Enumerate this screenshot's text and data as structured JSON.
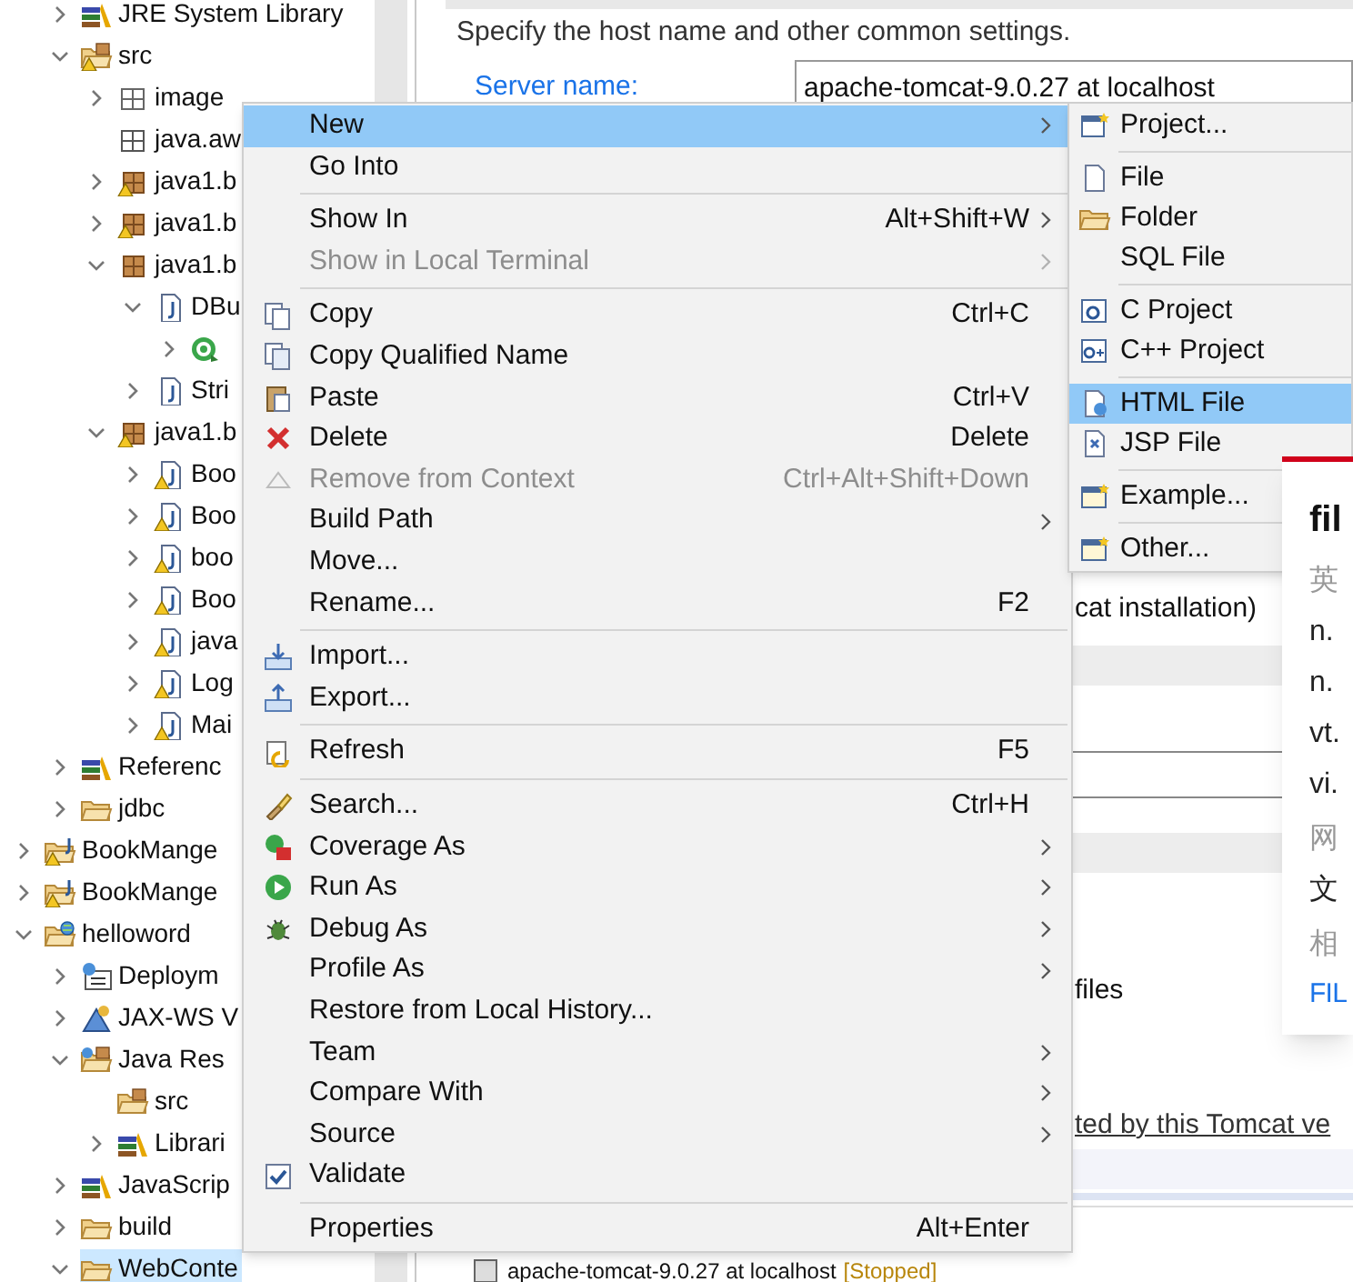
{
  "editor": {
    "description": "Specify the host name and other common settings.",
    "server_name_label": "Server name:",
    "server_name_value": "apache-tomcat-9.0.27 at localhost",
    "fragments": [
      {
        "kind": "runtime",
        "text": "cat installation)"
      },
      {
        "kind": "files",
        "text": "files"
      },
      {
        "kind": "link",
        "text": "ted by this Tomcat ve"
      }
    ]
  },
  "tree": {
    "continued_items": [
      {
        "label": "JRE System Library",
        "kind": "library",
        "expanded": false,
        "selected": false
      },
      {
        "label": "src",
        "kind": "source-folder-warning",
        "expanded": true,
        "selected": false,
        "children": [
          {
            "label": "image",
            "kind": "package-outline",
            "expanded": false,
            "selected": false
          },
          {
            "label": "java.aw",
            "kind": "package-empty",
            "selected": false
          },
          {
            "label": "java1.b",
            "kind": "package-warning",
            "expanded": false,
            "selected": false
          },
          {
            "label": "java1.b",
            "kind": "package-warning",
            "expanded": false,
            "selected": false
          },
          {
            "label": "java1.b",
            "kind": "package",
            "expanded": true,
            "selected": false,
            "children": [
              {
                "label": "DBu",
                "kind": "java-file",
                "expanded": true,
                "selected": false,
                "children": [
                  {
                    "kind": "class",
                    "expanded": false,
                    "selected": false
                  }
                ]
              },
              {
                "label": "Stri",
                "kind": "java-file",
                "expanded": false,
                "selected": false
              }
            ]
          },
          {
            "label": "java1.b",
            "kind": "package-warning",
            "expanded": true,
            "selected": false,
            "children": [
              {
                "label": "Boo",
                "kind": "java-file-warning",
                "expanded": false,
                "selected": false
              },
              {
                "label": "Boo",
                "kind": "java-file-warning",
                "expanded": false,
                "selected": false
              },
              {
                "label": "boo",
                "kind": "java-file-warning",
                "expanded": false,
                "selected": false
              },
              {
                "label": "Boo",
                "kind": "java-file-warning",
                "expanded": false,
                "selected": false
              },
              {
                "label": "java",
                "kind": "java-file-warning",
                "expanded": false,
                "selected": false
              },
              {
                "label": "Log",
                "kind": "java-file-warning",
                "expanded": false,
                "selected": false
              },
              {
                "label": "Mai",
                "kind": "java-file-warning",
                "expanded": false,
                "selected": false
              }
            ]
          }
        ]
      },
      {
        "label": "Referenc",
        "kind": "library",
        "expanded": false,
        "selected": false
      },
      {
        "label": "jdbc",
        "kind": "folder",
        "expanded": false,
        "selected": false
      }
    ],
    "items": [
      {
        "label": "BookMange",
        "kind": "project-warning",
        "expanded": false,
        "selected": false
      },
      {
        "label": "BookMange",
        "kind": "project-warning",
        "expanded": false,
        "selected": false
      },
      {
        "label": "helloword",
        "kind": "web-project",
        "expanded": true,
        "selected": false,
        "children": [
          {
            "label": "Deploym",
            "kind": "deployment",
            "expanded": false,
            "selected": false
          },
          {
            "label": "JAX-WS V",
            "kind": "webservices",
            "expanded": false,
            "selected": false
          },
          {
            "label": "Java Res",
            "kind": "java-resources",
            "expanded": true,
            "selected": false,
            "children": [
              {
                "label": "src",
                "kind": "source-folder",
                "selected": false
              },
              {
                "label": "Librari",
                "kind": "library",
                "expanded": false,
                "selected": false
              }
            ]
          },
          {
            "label": "JavaScrip",
            "kind": "library",
            "expanded": false,
            "selected": false
          },
          {
            "label": "build",
            "kind": "folder",
            "expanded": false,
            "selected": false
          },
          {
            "label": "WebConte",
            "kind": "folder",
            "expanded": true,
            "selected": true
          }
        ]
      }
    ]
  },
  "context_menu": {
    "items": [
      {
        "kind": "item",
        "label": "New",
        "submenu": true,
        "disabled": false,
        "selected": true
      },
      {
        "kind": "item",
        "label": "Go Into",
        "submenu": false,
        "disabled": false,
        "selected": false
      },
      {
        "kind": "separator"
      },
      {
        "kind": "item",
        "label": "Show In",
        "shortcut": "Alt+Shift+W",
        "submenu": true,
        "disabled": false,
        "selected": false
      },
      {
        "kind": "item",
        "label": "Show in Local Terminal",
        "submenu": true,
        "disabled": true,
        "selected": false
      },
      {
        "kind": "separator"
      },
      {
        "kind": "item",
        "label": "Copy",
        "shortcut": "Ctrl+C",
        "submenu": false,
        "disabled": false,
        "selected": false
      },
      {
        "kind": "item",
        "label": "Copy Qualified Name",
        "submenu": false,
        "disabled": false,
        "selected": false
      },
      {
        "kind": "item",
        "label": "Paste",
        "shortcut": "Ctrl+V",
        "submenu": false,
        "disabled": false,
        "selected": false
      },
      {
        "kind": "item",
        "label": "Delete",
        "shortcut": "Delete",
        "submenu": false,
        "disabled": false,
        "selected": false
      },
      {
        "kind": "item",
        "label": "Remove from Context",
        "shortcut": "Ctrl+Alt+Shift+Down",
        "submenu": false,
        "disabled": true,
        "selected": false
      },
      {
        "kind": "item",
        "label": "Build Path",
        "submenu": true,
        "disabled": false,
        "selected": false
      },
      {
        "kind": "item",
        "label": "Move...",
        "submenu": false,
        "disabled": false,
        "selected": false
      },
      {
        "kind": "item",
        "label": "Rename...",
        "shortcut": "F2",
        "submenu": false,
        "disabled": false,
        "selected": false
      },
      {
        "kind": "separator"
      },
      {
        "kind": "item",
        "label": "Import...",
        "submenu": false,
        "disabled": false,
        "selected": false
      },
      {
        "kind": "item",
        "label": "Export...",
        "submenu": false,
        "disabled": false,
        "selected": false
      },
      {
        "kind": "separator"
      },
      {
        "kind": "item",
        "label": "Refresh",
        "shortcut": "F5",
        "submenu": false,
        "disabled": false,
        "selected": false
      },
      {
        "kind": "separator"
      },
      {
        "kind": "item",
        "label": "Search...",
        "shortcut": "Ctrl+H",
        "submenu": false,
        "disabled": false,
        "selected": false
      },
      {
        "kind": "item",
        "label": "Coverage As",
        "submenu": true,
        "disabled": false,
        "selected": false
      },
      {
        "kind": "item",
        "label": "Run As",
        "submenu": true,
        "disabled": false,
        "selected": false
      },
      {
        "kind": "item",
        "label": "Debug As",
        "submenu": true,
        "disabled": false,
        "selected": false
      },
      {
        "kind": "item",
        "label": "Profile As",
        "submenu": true,
        "disabled": false,
        "selected": false
      },
      {
        "kind": "item",
        "label": "Restore from Local History...",
        "submenu": false,
        "disabled": false,
        "selected": false
      },
      {
        "kind": "item",
        "label": "Team",
        "submenu": true,
        "disabled": false,
        "selected": false
      },
      {
        "kind": "item",
        "label": "Compare With",
        "submenu": true,
        "disabled": false,
        "selected": false
      },
      {
        "kind": "item",
        "label": "Source",
        "submenu": true,
        "disabled": false,
        "selected": false
      },
      {
        "kind": "item",
        "label": "Validate",
        "submenu": false,
        "disabled": false,
        "selected": false
      },
      {
        "kind": "separator"
      },
      {
        "kind": "item",
        "label": "Properties",
        "shortcut": "Alt+Enter",
        "submenu": false,
        "disabled": false,
        "selected": false
      }
    ]
  },
  "new_submenu": {
    "items": [
      {
        "kind": "item",
        "label": "Project...",
        "selected": false
      },
      {
        "kind": "separator"
      },
      {
        "kind": "item",
        "label": "File",
        "selected": false
      },
      {
        "kind": "item",
        "label": "Folder",
        "selected": false
      },
      {
        "kind": "item",
        "label": "SQL File",
        "selected": false
      },
      {
        "kind": "separator"
      },
      {
        "kind": "item",
        "label": "C Project",
        "selected": false
      },
      {
        "kind": "item",
        "label": "C++ Project",
        "selected": false
      },
      {
        "kind": "separator"
      },
      {
        "kind": "item",
        "label": "HTML File",
        "selected": true
      },
      {
        "kind": "item",
        "label": "JSP File",
        "selected": false
      },
      {
        "kind": "separator"
      },
      {
        "kind": "item",
        "label": "Example...",
        "selected": false
      },
      {
        "kind": "separator"
      },
      {
        "kind": "item",
        "label": "Other...",
        "selected": false
      }
    ]
  },
  "dictionary_popup": {
    "headword": "fil",
    "lines": [
      {
        "kind": "note",
        "text": "英"
      },
      {
        "kind": "sense",
        "text": "n."
      },
      {
        "kind": "sense",
        "text": "n."
      },
      {
        "kind": "sense",
        "text": "vt."
      },
      {
        "kind": "sense",
        "text": "vi."
      },
      {
        "kind": "note",
        "text": "网"
      },
      {
        "kind": "sense",
        "text": "文"
      },
      {
        "kind": "note",
        "text": "相"
      },
      {
        "kind": "link",
        "text": "FIL"
      }
    ]
  },
  "servers_view": {
    "server": "apache-tomcat-9.0.27 at localhost",
    "state": "[Stopped]"
  }
}
